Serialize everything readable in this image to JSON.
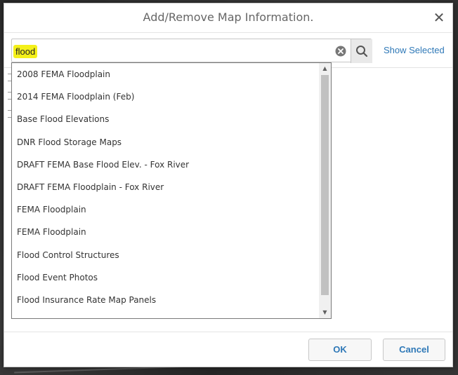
{
  "dialog": {
    "title": "Add/Remove Map Information.",
    "close_glyph": "✕"
  },
  "search": {
    "value": "flood",
    "clear_icon": "clear-circle-icon",
    "search_icon": "magnifier-icon"
  },
  "show_selected_label": "Show Selected",
  "dropdown": {
    "items": [
      "2008 FEMA Floodplain",
      "2014 FEMA Floodplain (Feb)",
      "Base Flood Elevations",
      "DNR Flood Storage Maps",
      "DRAFT FEMA Base Flood Elev. - Fox River",
      "DRAFT FEMA Floodplain - Fox River",
      "FEMA Floodplain",
      "FEMA Floodplain",
      "Flood Control Structures",
      "Flood Event Photos",
      "Flood Insurance Rate Map Panels"
    ]
  },
  "footer": {
    "ok_label": "OK",
    "cancel_label": "Cancel"
  },
  "colors": {
    "accent": "#2e78b7",
    "highlight": "#f4f01a"
  }
}
